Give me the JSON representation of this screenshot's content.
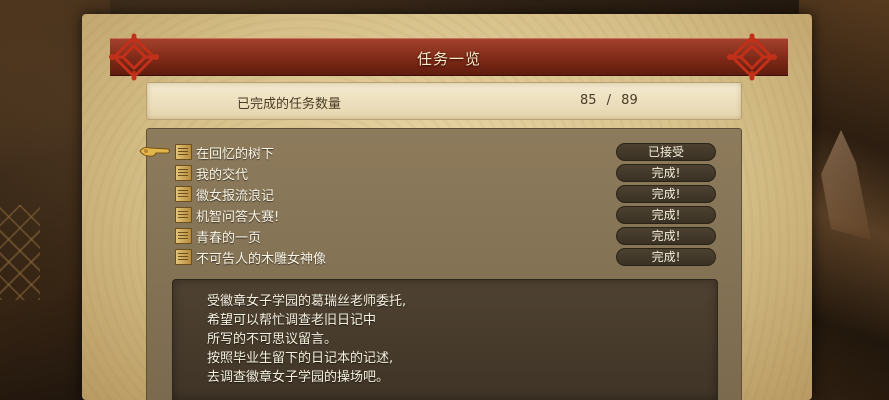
{
  "window": {
    "title": "任务一览"
  },
  "completed": {
    "label": "已完成的任务数量",
    "value": "85 / 89"
  },
  "quests": [
    {
      "name": "在回忆的树下",
      "status": "已接受",
      "selected": true
    },
    {
      "name": "我的交代",
      "status": "完成!"
    },
    {
      "name": "徽女报流浪记",
      "status": "完成!"
    },
    {
      "name": "机智问答大赛!",
      "status": "完成!"
    },
    {
      "name": "青春的一页",
      "status": "完成!"
    },
    {
      "name": "不可告人的木雕女神像",
      "status": "完成!"
    }
  ],
  "description": {
    "lines": [
      "受徽章女子学园的葛瑞丝老师委托,",
      "希望可以帮忙调查老旧日记中",
      "所写的不可思议留言。",
      "按照毕业生留下的日记本的记述,",
      "去调查徽章女子学园的操场吧。"
    ]
  },
  "icons": {
    "cursor": "pointing-hand-icon",
    "quest": "scroll-icon",
    "ornament": "celtic-knot-ornament-icon"
  },
  "colors": {
    "banner": "#7e2a18",
    "parchment": "#d6bf88",
    "panel": "#7b6a4e",
    "status_pill": "#3a3124",
    "ornament": "#c3301a"
  }
}
